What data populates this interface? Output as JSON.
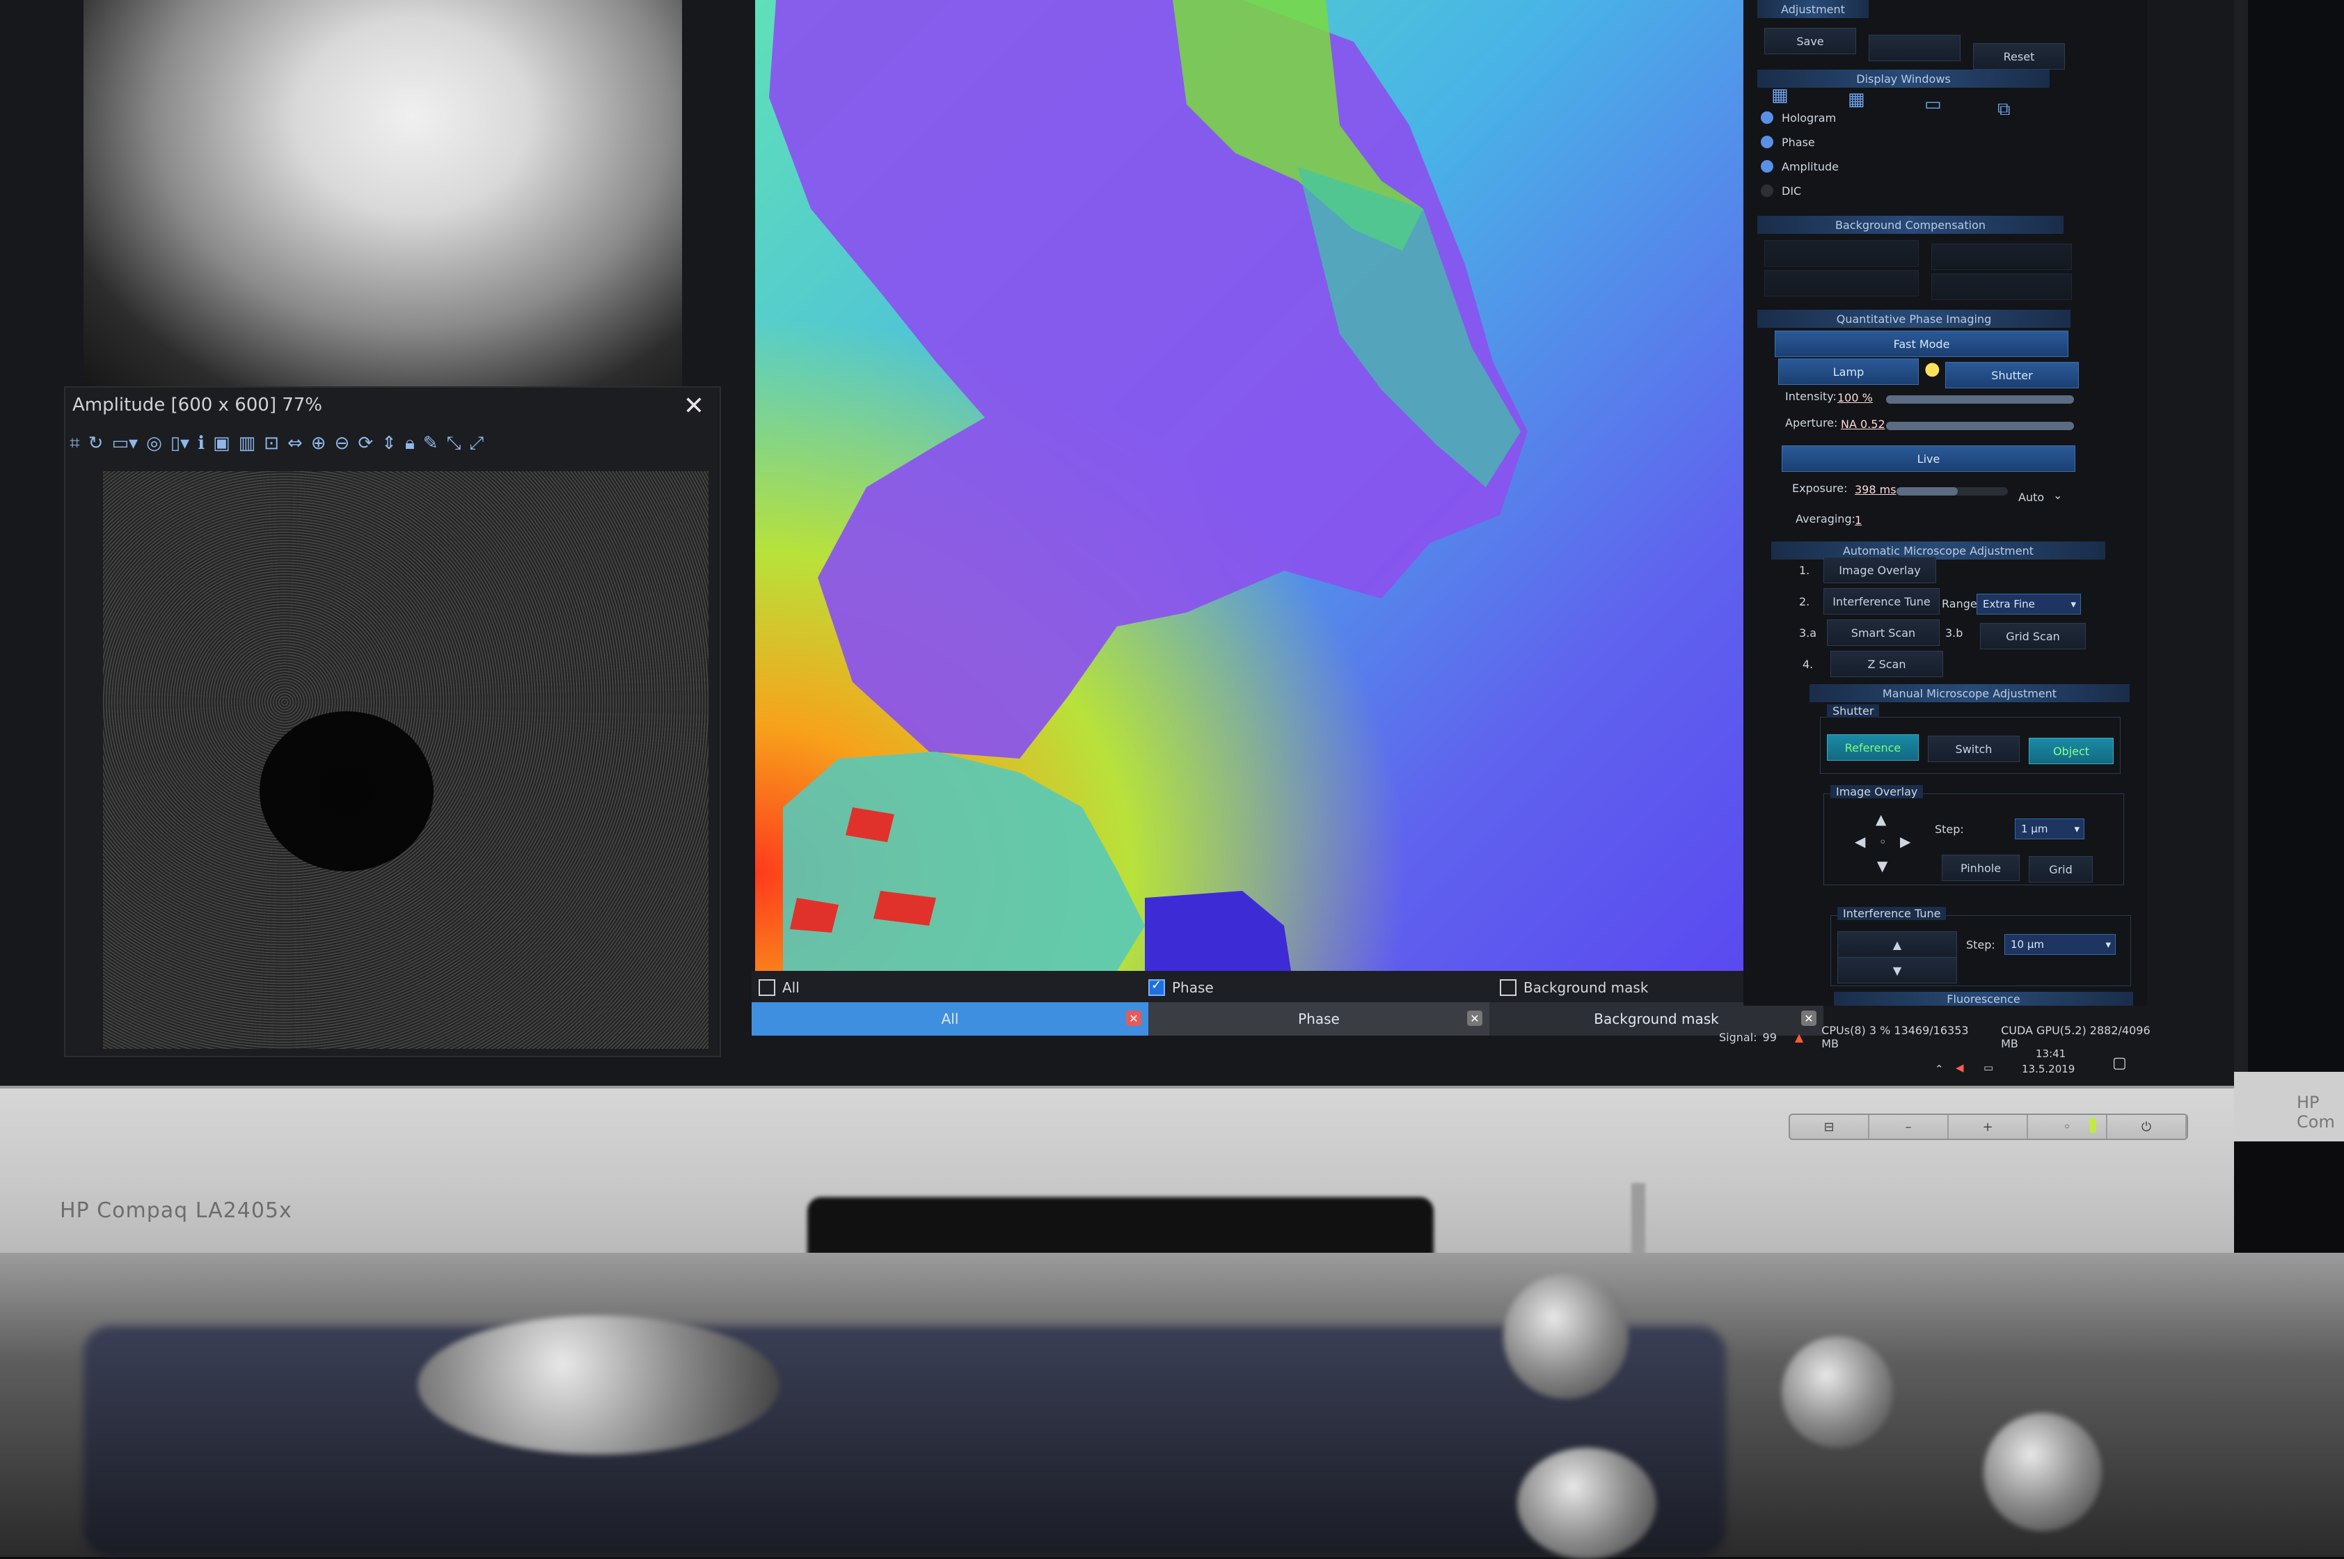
{
  "amplitude_window": {
    "title": "Amplitude [600 x 600] 77%",
    "close_icon": "close-icon"
  },
  "monitor": {
    "brand": "HP Compaq LA2405x",
    "secondary_brand": "HP Com"
  },
  "phase_view": {
    "checkbox_all": "All",
    "checkbox_phase": "Phase",
    "checkbox_background_mask": "Background mask",
    "tabs": [
      {
        "label": "All"
      },
      {
        "label": "Phase"
      },
      {
        "label": "Background mask"
      }
    ]
  },
  "panel": {
    "top": {
      "section": "Adjustment",
      "save": "Save",
      "reset": "Reset"
    },
    "display_windows": {
      "section": "Display Windows",
      "items": [
        "Hologram",
        "Phase",
        "Amplitude",
        "DIC"
      ]
    },
    "background_compensation": {
      "section": "Background Compensation"
    },
    "qpi": {
      "section": "Quantitative Phase Imaging",
      "fast_mode": "Fast Mode",
      "lamp": "Lamp",
      "shutter": "Shutter",
      "intensity_label": "Intensity:",
      "intensity_value": "100 %",
      "aperture_label": "Aperture:",
      "aperture_value": "NA 0.52",
      "live": "Live",
      "exposure_label": "Exposure:",
      "exposure_value": "398 ms",
      "exposure_mode": "Auto",
      "averaging_label": "Averaging:",
      "averaging_value": "1"
    },
    "auto_adjust": {
      "section": "Automatic Microscope Adjustment",
      "steps": [
        {
          "num": "1.",
          "label": "Image Overlay"
        },
        {
          "num": "2.",
          "label": "Interference Tune"
        },
        {
          "num": "3.a",
          "label": "Smart Scan"
        },
        {
          "num": "4.",
          "label": "Z Scan"
        }
      ],
      "range_label": "Range:",
      "range_value": "Extra Fine",
      "step_3b": "3.b",
      "grid_scan": "Grid Scan"
    },
    "manual_adjust": {
      "section": "Manual Microscope Adjustment",
      "shutter_group": "Shutter",
      "reference": "Reference",
      "switch": "Switch",
      "object": "Object",
      "image_overlay_group": "Image Overlay",
      "step_label": "Step:",
      "step_value": "1 µm",
      "pinhole": "Pinhole",
      "grid": "Grid",
      "interference_tune_group": "Interference Tune",
      "it_step_label": "Step:",
      "it_step_value": "10 µm"
    },
    "fluorescence": {
      "section": "Fluorescence"
    }
  },
  "status_bar": {
    "signal_label": "Signal:",
    "signal_value": "99",
    "cpu": "CPUs(8)  3 %  13469/16353 MB",
    "gpu": "CUDA GPU(5.2)  2882/4096 MB"
  },
  "tray": {
    "time": "13:41",
    "date": "13.5.2019"
  },
  "taskbar": [
    {
      "name": "windows-start-icon",
      "glyph": "⊞"
    },
    {
      "name": "task-view-icon",
      "glyph": "⧉"
    },
    {
      "name": "file-explorer-icon",
      "glyph": "▭"
    },
    {
      "name": "firefox-icon",
      "glyph": "◉"
    },
    {
      "name": "save-app-icon",
      "glyph": "▣"
    },
    {
      "name": "microscope-app-icon",
      "glyph": "●"
    }
  ],
  "colors": {
    "accent": "#3f8fe1",
    "panel_bg": "#121418",
    "object_text": "#8cff8a"
  }
}
